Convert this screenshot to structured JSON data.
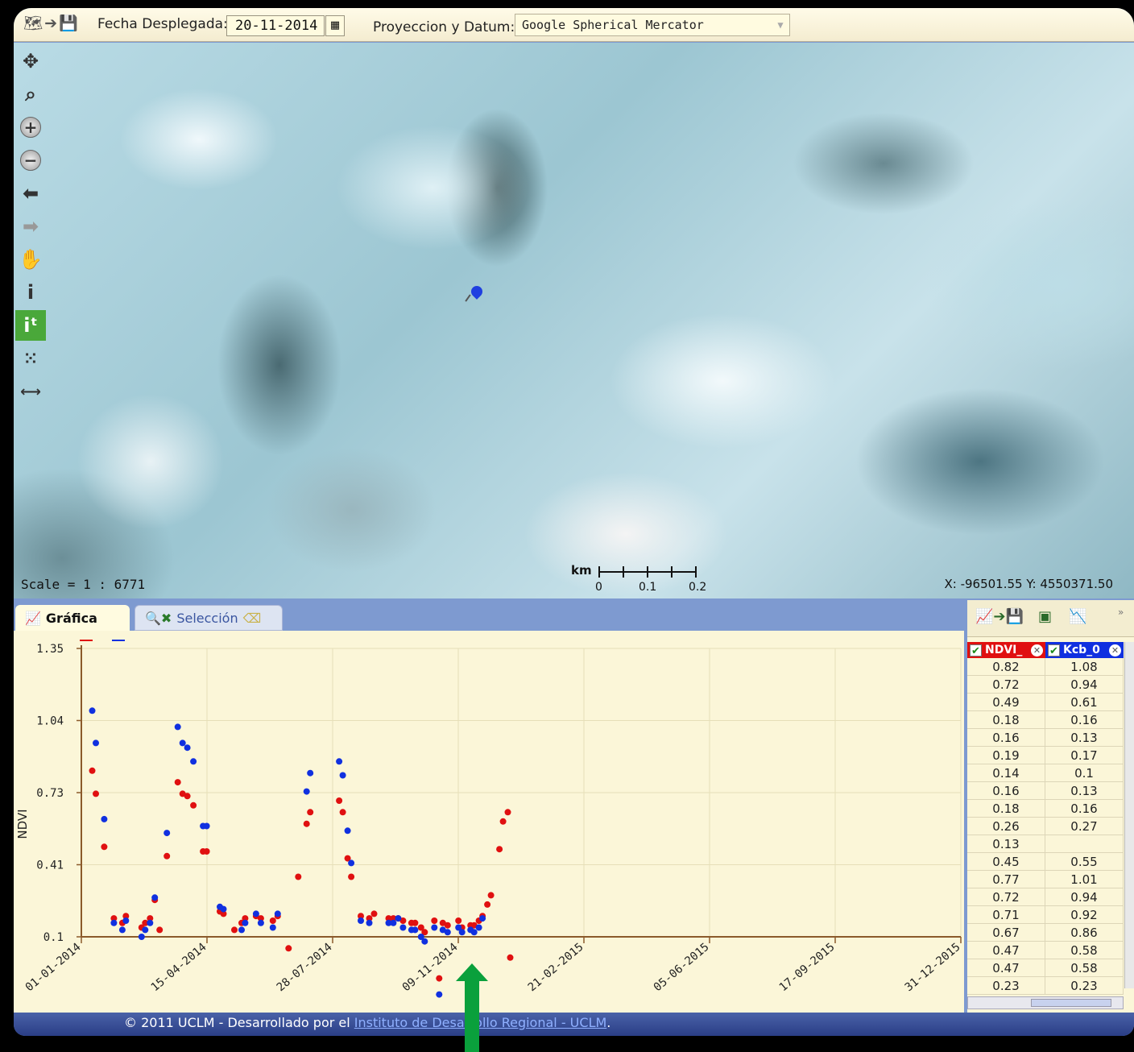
{
  "topbar": {
    "date_label": "Fecha Desplegada:",
    "date_value": "20-11-2014",
    "proj_label": "Proyeccion y Datum:",
    "proj_value": "Google Spherical Mercator"
  },
  "map": {
    "scale_text": "Scale = 1 : 6771",
    "coords_text": "X: -96501.55 Y: 4550371.50",
    "scalebar_unit": "km",
    "scalebar_labels": [
      "0",
      "0.1",
      "0.2"
    ],
    "tools": [
      "pan-icon",
      "zoom-box-icon",
      "zoom-in-icon",
      "zoom-out-icon",
      "back-icon",
      "forward-icon",
      "hand-icon",
      "info-icon",
      "info-time-icon",
      "select-points-icon",
      "measure-icon"
    ]
  },
  "tabs": {
    "grafica": "Gráfica",
    "seleccion": "Selección"
  },
  "chart_data": {
    "type": "scatter",
    "ylabel": "NDVI",
    "y_ticks": [
      "1.35",
      "1.04",
      "0.73",
      "0.41",
      "0.1"
    ],
    "x_ticks": [
      "01-01-2014",
      "15-04-2014",
      "28-07-2014",
      "09-11-2014",
      "21-02-2015",
      "05-06-2015",
      "17-09-2015",
      "31-12-2015"
    ],
    "ylim": [
      0.1,
      1.35
    ],
    "series": [
      {
        "color": "#e01010",
        "points": [
          [
            9,
            0.82
          ],
          [
            12,
            0.72
          ],
          [
            19,
            0.49
          ],
          [
            27,
            0.18
          ],
          [
            34,
            0.16
          ],
          [
            37,
            0.19
          ],
          [
            50,
            0.14
          ],
          [
            53,
            0.16
          ],
          [
            57,
            0.18
          ],
          [
            61,
            0.26
          ],
          [
            65,
            0.13
          ],
          [
            71,
            0.45
          ],
          [
            80,
            0.77
          ],
          [
            84,
            0.72
          ],
          [
            88,
            0.71
          ],
          [
            93,
            0.67
          ],
          [
            101,
            0.47
          ],
          [
            104,
            0.47
          ],
          [
            115,
            0.21
          ],
          [
            118,
            0.2
          ],
          [
            127,
            0.13
          ],
          [
            133,
            0.16
          ],
          [
            136,
            0.18
          ],
          [
            145,
            0.19
          ],
          [
            149,
            0.18
          ],
          [
            159,
            0.17
          ],
          [
            163,
            0.19
          ],
          [
            172,
            0.05
          ],
          [
            180,
            0.36
          ],
          [
            187,
            0.59
          ],
          [
            190,
            0.64
          ],
          [
            214,
            0.69
          ],
          [
            217,
            0.64
          ],
          [
            221,
            0.44
          ],
          [
            224,
            0.36
          ],
          [
            232,
            0.19
          ],
          [
            239,
            0.18
          ],
          [
            243,
            0.2
          ],
          [
            255,
            0.18
          ],
          [
            259,
            0.18
          ],
          [
            263,
            0.18
          ],
          [
            267,
            0.17
          ],
          [
            274,
            0.16
          ],
          [
            277,
            0.16
          ],
          [
            282,
            0.14
          ],
          [
            285,
            0.12
          ],
          [
            293,
            0.17
          ],
          [
            297,
            -0.08
          ],
          [
            300,
            0.16
          ],
          [
            304,
            0.15
          ],
          [
            313,
            0.17
          ],
          [
            316,
            0.14
          ],
          [
            323,
            0.15
          ],
          [
            326,
            0.15
          ],
          [
            330,
            0.17
          ],
          [
            333,
            0.19
          ],
          [
            337,
            0.24
          ],
          [
            340,
            0.28
          ],
          [
            347,
            0.48
          ],
          [
            350,
            0.6
          ],
          [
            354,
            0.64
          ],
          [
            356,
            0.01
          ]
        ]
      },
      {
        "color": "#1030e0",
        "points": [
          [
            9,
            1.08
          ],
          [
            12,
            0.94
          ],
          [
            19,
            0.61
          ],
          [
            27,
            0.16
          ],
          [
            34,
            0.13
          ],
          [
            37,
            0.17
          ],
          [
            50,
            0.1
          ],
          [
            53,
            0.13
          ],
          [
            57,
            0.16
          ],
          [
            61,
            0.27
          ],
          [
            71,
            0.55
          ],
          [
            80,
            1.01
          ],
          [
            84,
            0.94
          ],
          [
            88,
            0.92
          ],
          [
            93,
            0.86
          ],
          [
            101,
            0.58
          ],
          [
            104,
            0.58
          ],
          [
            115,
            0.23
          ],
          [
            118,
            0.22
          ],
          [
            133,
            0.13
          ],
          [
            136,
            0.16
          ],
          [
            145,
            0.2
          ],
          [
            149,
            0.16
          ],
          [
            159,
            0.14
          ],
          [
            163,
            0.2
          ],
          [
            187,
            0.73
          ],
          [
            190,
            0.81
          ],
          [
            214,
            0.86
          ],
          [
            217,
            0.8
          ],
          [
            221,
            0.56
          ],
          [
            224,
            0.42
          ],
          [
            232,
            0.17
          ],
          [
            239,
            0.16
          ],
          [
            255,
            0.16
          ],
          [
            259,
            0.16
          ],
          [
            263,
            0.18
          ],
          [
            267,
            0.14
          ],
          [
            274,
            0.13
          ],
          [
            277,
            0.13
          ],
          [
            282,
            0.1
          ],
          [
            285,
            0.08
          ],
          [
            293,
            0.14
          ],
          [
            297,
            -0.15
          ],
          [
            300,
            0.13
          ],
          [
            304,
            0.12
          ],
          [
            313,
            0.14
          ],
          [
            316,
            0.12
          ],
          [
            323,
            0.13
          ],
          [
            326,
            0.12
          ],
          [
            330,
            0.14
          ],
          [
            333,
            0.18
          ]
        ]
      }
    ]
  },
  "table": {
    "col1": "NDVI_",
    "col2": "Kcb_0",
    "rows": [
      [
        "0.82",
        "1.08"
      ],
      [
        "0.72",
        "0.94"
      ],
      [
        "0.49",
        "0.61"
      ],
      [
        "0.18",
        "0.16"
      ],
      [
        "0.16",
        "0.13"
      ],
      [
        "0.19",
        "0.17"
      ],
      [
        "0.14",
        "0.1"
      ],
      [
        "0.16",
        "0.13"
      ],
      [
        "0.18",
        "0.16"
      ],
      [
        "0.26",
        "0.27"
      ],
      [
        "0.13",
        ""
      ],
      [
        "0.45",
        "0.55"
      ],
      [
        "0.77",
        "1.01"
      ],
      [
        "0.72",
        "0.94"
      ],
      [
        "0.71",
        "0.92"
      ],
      [
        "0.67",
        "0.86"
      ],
      [
        "0.47",
        "0.58"
      ],
      [
        "0.47",
        "0.58"
      ],
      [
        "0.23",
        "0.23"
      ]
    ]
  },
  "footer": {
    "prefix": "© 2011 UCLM - Desarrollado por el ",
    "link": "Instituto de Desarrollo Regional - UCLM",
    "suffix": "."
  }
}
